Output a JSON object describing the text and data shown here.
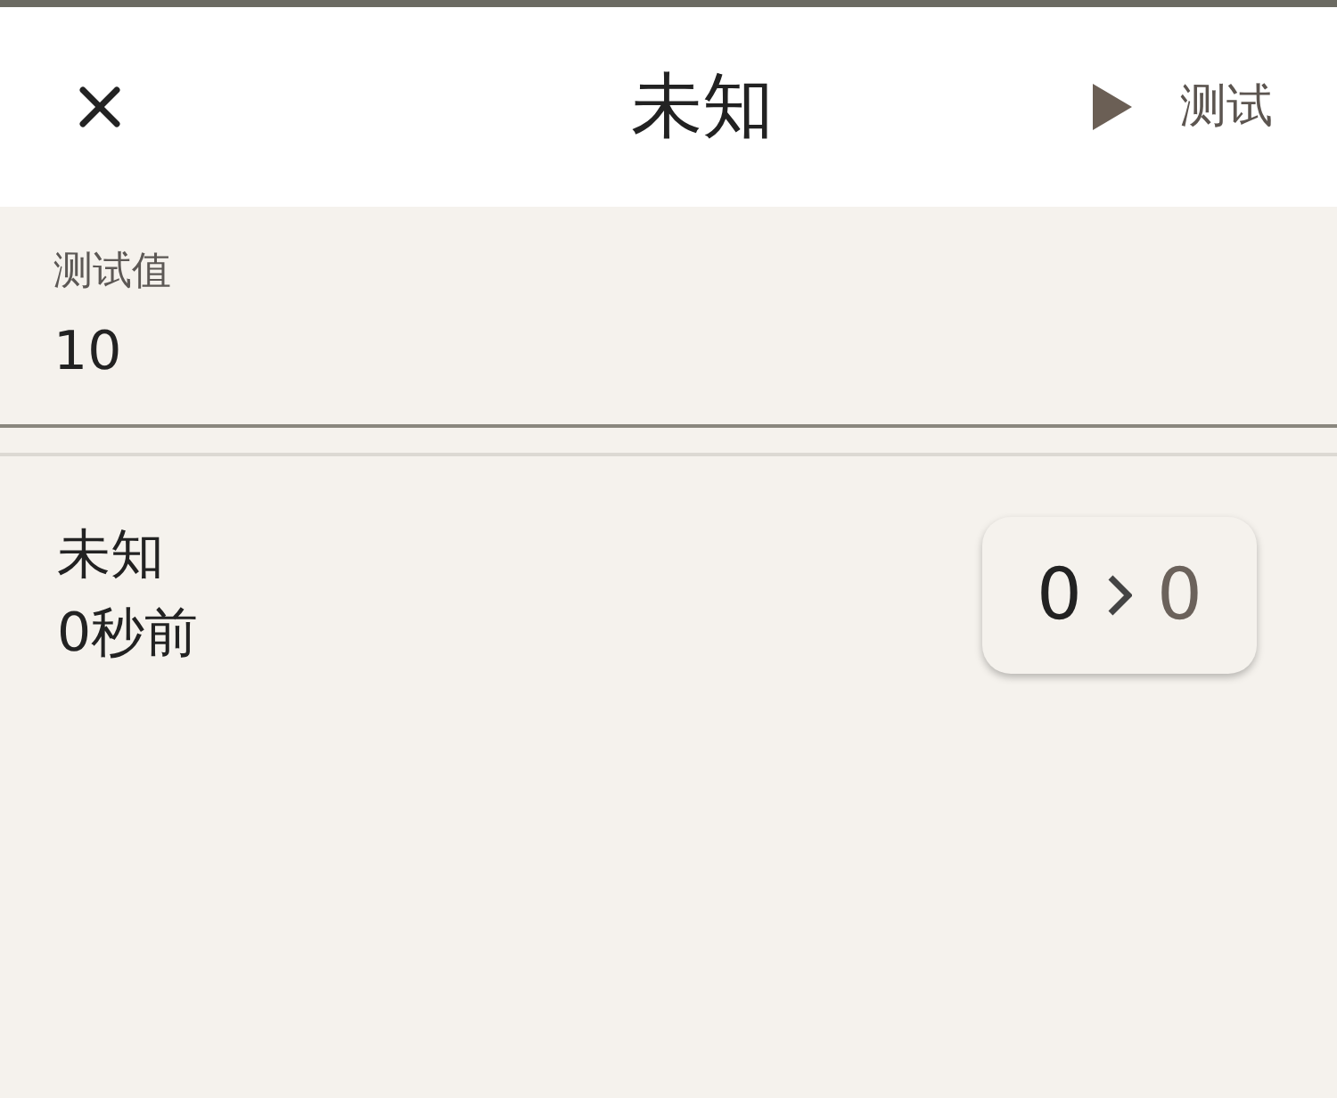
{
  "header": {
    "title": "未知",
    "test_button": "测试"
  },
  "field": {
    "label": "测试值",
    "value": "10"
  },
  "entry": {
    "name": "未知",
    "time": "0秒前",
    "from_value": "0",
    "to_value": "0"
  }
}
